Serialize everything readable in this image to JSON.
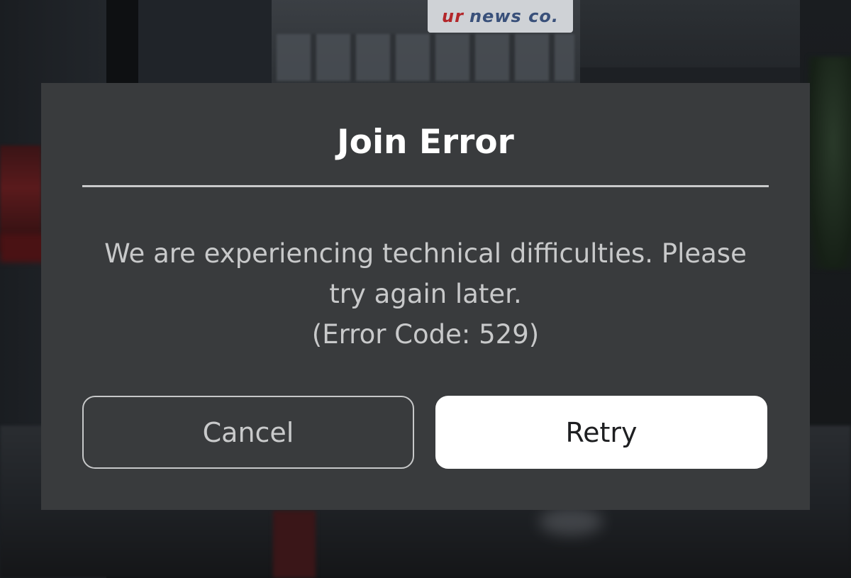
{
  "background": {
    "sign_text_red": "ur",
    "sign_text_blue": "news co."
  },
  "dialog": {
    "title": "Join Error",
    "message_line1": "We are experiencing technical difficulties. Please",
    "message_line2": "try again later.",
    "message_line3": "(Error Code: 529)",
    "cancel_label": "Cancel",
    "retry_label": "Retry"
  },
  "colors": {
    "dialog_background": "#393b3d",
    "title_text": "#ffffff",
    "message_text": "#c8c9ca",
    "retry_background": "#ffffff"
  }
}
